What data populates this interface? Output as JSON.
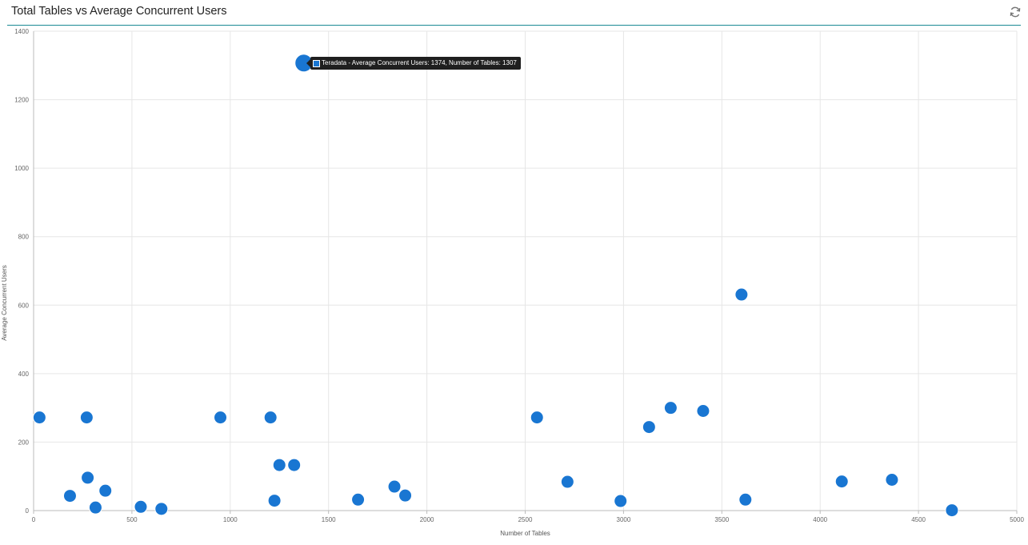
{
  "panel": {
    "title": "Total Tables vs Average Concurrent Users",
    "refresh_icon": "refresh-icon"
  },
  "tooltip": {
    "series": "Teradata",
    "text": "Teradata - Average Concurrent Users: 1374, Number of Tables: 1307"
  },
  "chart_data": {
    "type": "scatter",
    "xlabel": "Number of Tables",
    "ylabel": "Average Concurrent Users",
    "xlim": [
      0,
      5000
    ],
    "ylim": [
      0,
      1400
    ],
    "x_ticks": [
      "0",
      "500",
      "1000",
      "1500",
      "2000",
      "2500",
      "3000",
      "3500",
      "4000",
      "4500",
      "5000"
    ],
    "y_ticks": [
      "0",
      "200",
      "400",
      "600",
      "800",
      "1000",
      "1200",
      "1400"
    ],
    "grid": true,
    "color": "#1976d2",
    "series": [
      {
        "name": "Teradata",
        "points": [
          {
            "x": 30,
            "y": 272
          },
          {
            "x": 185,
            "y": 43
          },
          {
            "x": 270,
            "y": 272
          },
          {
            "x": 275,
            "y": 96
          },
          {
            "x": 315,
            "y": 9
          },
          {
            "x": 365,
            "y": 58
          },
          {
            "x": 545,
            "y": 11
          },
          {
            "x": 650,
            "y": 5
          },
          {
            "x": 950,
            "y": 272
          },
          {
            "x": 1205,
            "y": 272
          },
          {
            "x": 1225,
            "y": 29
          },
          {
            "x": 1250,
            "y": 133
          },
          {
            "x": 1325,
            "y": 133
          },
          {
            "x": 1374,
            "y": 1307
          },
          {
            "x": 1650,
            "y": 32
          },
          {
            "x": 1835,
            "y": 70
          },
          {
            "x": 1890,
            "y": 44
          },
          {
            "x": 2560,
            "y": 272
          },
          {
            "x": 2715,
            "y": 84
          },
          {
            "x": 2985,
            "y": 28
          },
          {
            "x": 3130,
            "y": 244
          },
          {
            "x": 3240,
            "y": 300
          },
          {
            "x": 3405,
            "y": 291
          },
          {
            "x": 3600,
            "y": 631
          },
          {
            "x": 3620,
            "y": 32
          },
          {
            "x": 4110,
            "y": 85
          },
          {
            "x": 4365,
            "y": 90
          },
          {
            "x": 4670,
            "y": 1
          }
        ]
      }
    ]
  }
}
